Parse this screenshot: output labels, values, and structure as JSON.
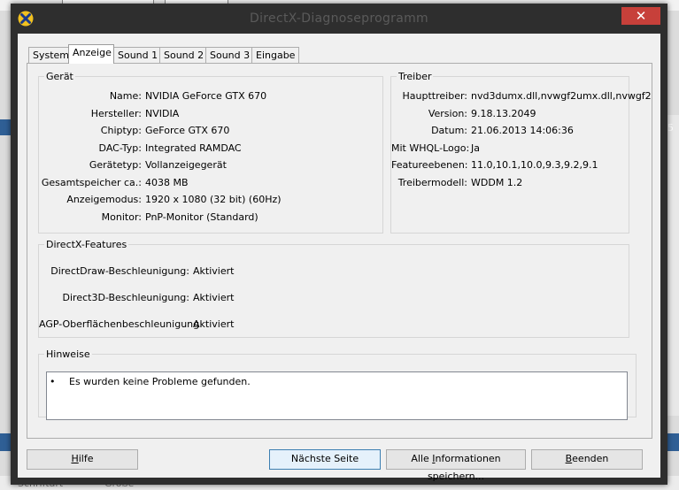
{
  "window": {
    "title": "DirectX-Diagnoseprogramm",
    "close_label": "✕"
  },
  "tabs": [
    {
      "label": "System",
      "active": false
    },
    {
      "label": "Anzeige",
      "active": true
    },
    {
      "label": "Sound 1",
      "active": false
    },
    {
      "label": "Sound 2",
      "active": false
    },
    {
      "label": "Sound 3",
      "active": false
    },
    {
      "label": "Eingabe",
      "active": false
    }
  ],
  "device": {
    "title": "Gerät",
    "rows": [
      {
        "label": "Name:",
        "value": "NVIDIA GeForce GTX 670"
      },
      {
        "label": "Hersteller:",
        "value": "NVIDIA"
      },
      {
        "label": "Chiptyp:",
        "value": "GeForce GTX 670"
      },
      {
        "label": "DAC-Typ:",
        "value": "Integrated RAMDAC"
      },
      {
        "label": "Gerätetyp:",
        "value": "Vollanzeigegerät"
      },
      {
        "label": "Gesamtspeicher ca.:",
        "value": "4038 MB"
      },
      {
        "label": "Anzeigemodus:",
        "value": "1920 x 1080 (32 bit) (60Hz)"
      },
      {
        "label": "Monitor:",
        "value": "PnP-Monitor (Standard)"
      }
    ]
  },
  "driver": {
    "title": "Treiber",
    "rows": [
      {
        "label": "Haupttreiber:",
        "value": "nvd3dumx.dll,nvwgf2umx.dll,nvwgf2"
      },
      {
        "label": "Version:",
        "value": "9.18.13.2049"
      },
      {
        "label": "Datum:",
        "value": "21.06.2013 14:06:36"
      },
      {
        "label": "Mit WHQL-Logo:",
        "value": "Ja"
      },
      {
        "label": "Featureebenen:",
        "value": "11.0,10.1,10.0,9.3,9.2,9.1"
      },
      {
        "label": "Treibermodell:",
        "value": "WDDM 1.2"
      }
    ]
  },
  "features": {
    "title": "DirectX-Features",
    "rows": [
      {
        "label": "DirectDraw-Beschleunigung:",
        "value": "Aktiviert"
      },
      {
        "label": "Direct3D-Beschleunigung:",
        "value": "Aktiviert"
      },
      {
        "label": "AGP-Oberflächenbeschleunigung:",
        "value": "Aktiviert"
      }
    ]
  },
  "notes": {
    "title": "Hinweise",
    "bullet": "•",
    "items": [
      "Es wurden keine Probleme gefunden."
    ]
  },
  "buttons": {
    "help": {
      "pre": "",
      "key": "H",
      "post": "ilfe"
    },
    "next": {
      "label": "Nächste Seite"
    },
    "save": {
      "pre": "Alle ",
      "key": "I",
      "post": "nformationen speichern..."
    },
    "quit": {
      "pre": "",
      "key": "B",
      "post": "eenden"
    }
  },
  "background": {
    "right_edge_text": "5",
    "bottom_items": [
      "Schriftart",
      "Größe"
    ]
  },
  "colors": {
    "close_button": "#c7403a",
    "title_bar": "#2e2e2e",
    "dialog_face": "#f0f0f0",
    "default_button_border": "#3c7fb1"
  }
}
